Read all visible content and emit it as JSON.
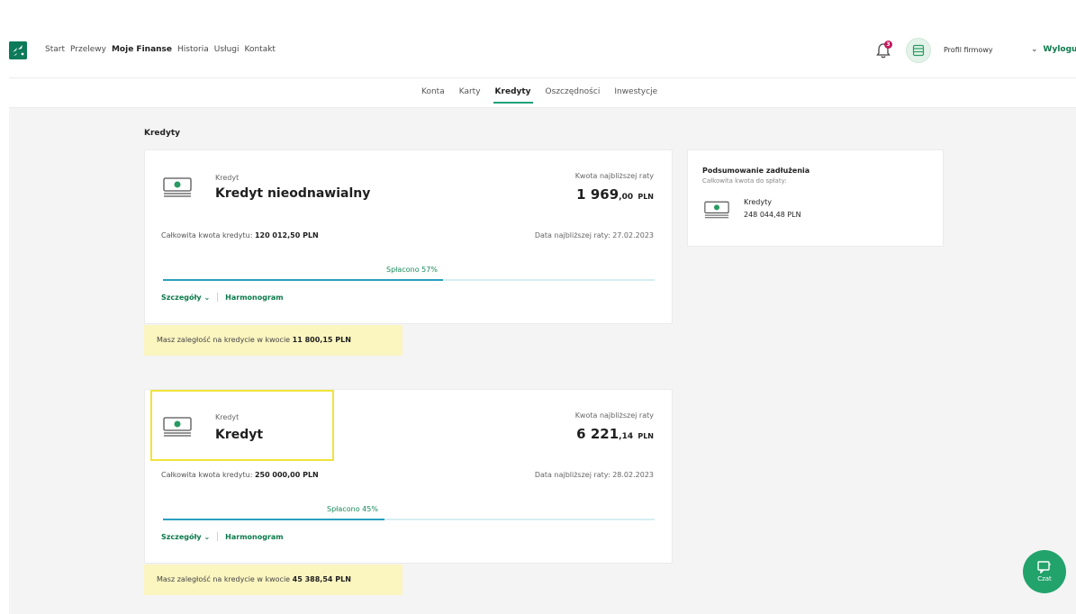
{
  "header": {
    "nav": [
      "Start",
      "Przelewy",
      "Moje Finanse",
      "Historia",
      "Usługi",
      "Kontakt"
    ],
    "active_nav": "Moje Finanse",
    "notification_count": "3",
    "profile_label": "Profil firmowy",
    "logout_label": "Wylogu"
  },
  "subnav": {
    "items": [
      "Konta",
      "Karty",
      "Kredyty",
      "Oszczędności",
      "Inwestycje"
    ],
    "active": "Kredyty"
  },
  "section_title": "Kredyty",
  "loans": [
    {
      "type_label": "Kredyt",
      "name": "Kredyt nieodnawialny",
      "next_installment_label": "Kwota najbliższej raty",
      "installment_whole": "1 969",
      "installment_decimal": ",00",
      "currency": "PLN",
      "total_label": "Całkowita kwota kredytu:",
      "total_value": "120 012,50 PLN",
      "next_date_label": "Data najbliższej raty: 27.02.2023",
      "paid_label": "Spłacono 57%",
      "paid_fraction": 0.57,
      "details_label": "Szczegóły",
      "schedule_label": "Harmonogram",
      "arrears_text": "Masz zaległość na kredycie w kwocie",
      "arrears_amount": "11 800,15 PLN"
    },
    {
      "type_label": "Kredyt",
      "name": "Kredyt",
      "next_installment_label": "Kwota najbliższej raty",
      "installment_whole": "6 221",
      "installment_decimal": ",14",
      "currency": "PLN",
      "total_label": "Całkowita kwota kredytu:",
      "total_value": "250 000,00 PLN",
      "next_date_label": "Data najbliższej raty: 28.02.2023",
      "paid_label": "Spłacono 45%",
      "paid_fraction": 0.45,
      "details_label": "Szczegóły",
      "schedule_label": "Harmonogram",
      "arrears_text": "Masz zaległość na kredycie w kwocie",
      "arrears_amount": "45 388,54 PLN"
    }
  ],
  "summary": {
    "title": "Podsumowanie zadłużenia",
    "subtitle": "Całkowita kwota do spłaty:",
    "item_label": "Kredyty",
    "item_value": "248 044,48 PLN"
  },
  "chat": {
    "label": "Czat"
  },
  "colors": {
    "brand": "#0d7a5a",
    "link": "#0b7a4b",
    "progress": "#2b9fbf",
    "arrears_bg": "#fbf5c0",
    "highlight": "#f0e33a",
    "chat": "#22a36b"
  }
}
